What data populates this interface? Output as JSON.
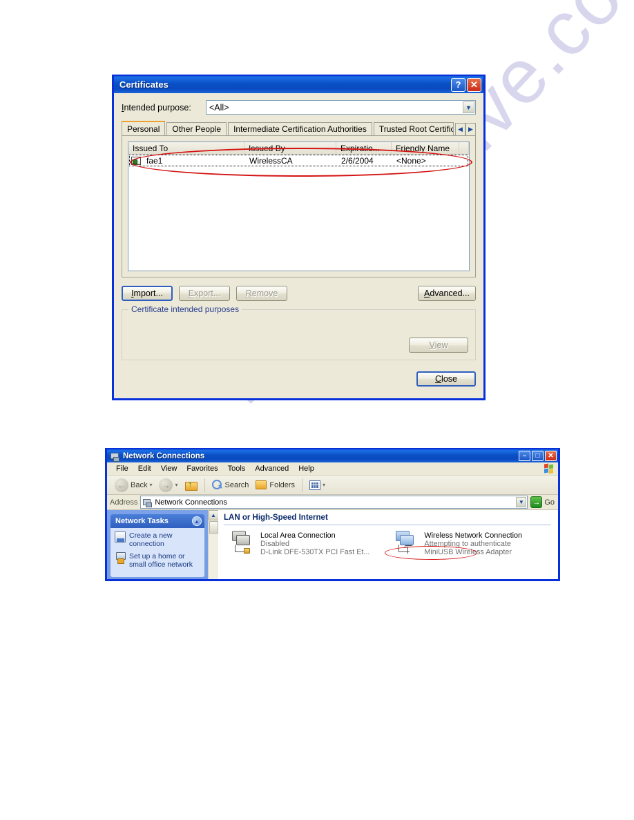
{
  "watermark": {
    "text": "manualshive.com"
  },
  "certificates_dialog": {
    "title": "Certificates",
    "titlebar_buttons": {
      "help": "?",
      "close": "✕"
    },
    "intended_purpose": {
      "label": "Intended purpose:",
      "label_mnemonic_prefix": "I",
      "label_mnemonic_char": "n",
      "label_rest": "tended purpose:",
      "value": "<All>",
      "arrow": "▼"
    },
    "tabs": [
      {
        "label": "Personal",
        "active": true
      },
      {
        "label": "Other People",
        "active": false
      },
      {
        "label": "Intermediate Certification Authorities",
        "active": false
      },
      {
        "label": "Trusted Root Certification",
        "active": false
      }
    ],
    "tab_scroll": {
      "left": "◀",
      "right": "▶"
    },
    "list": {
      "columns": [
        "Issued To",
        "Issued By",
        "Expiratio...",
        "Friendly Name"
      ],
      "rows": [
        {
          "issued_to": "fae1",
          "issued_by": "WirelessCA",
          "expiration": "2/6/2004",
          "friendly_name": "<None>",
          "selected": true
        }
      ]
    },
    "buttons": {
      "import": "Import...",
      "export": "Export...",
      "remove": "Remove",
      "advanced": "Advanced...",
      "view": "View",
      "close": "Close"
    },
    "group": {
      "title": "Certificate intended purposes",
      "content": ""
    }
  },
  "network_connections_window": {
    "title": "Network Connections",
    "titlebar_buttons": {
      "minimize": "–",
      "maximize": "□",
      "close": "✕"
    },
    "menus": [
      "File",
      "Edit",
      "View",
      "Favorites",
      "Tools",
      "Advanced",
      "Help"
    ],
    "toolbar": {
      "back": "Back",
      "forward": "",
      "up": "",
      "search": "Search",
      "folders": "Folders",
      "views": "",
      "caret": "▾"
    },
    "address_bar": {
      "label": "Address",
      "value": "Network Connections",
      "arrow": "▼",
      "go_label": "Go",
      "go_glyph": "→"
    },
    "sidebar": {
      "panel_title": "Network Tasks",
      "collapse_glyph": "▲",
      "tasks": [
        {
          "label": "Create a new connection",
          "icon": "new-connection-icon"
        },
        {
          "label": "Set up a home or small office network",
          "icon": "home-network-icon"
        }
      ]
    },
    "scrollbar": {
      "up": "▲",
      "down": "▼"
    },
    "main": {
      "group_header": "LAN or High-Speed Internet",
      "connections": [
        {
          "name": "Local Area Connection",
          "status": "Disabled",
          "device": "D-Link DFE-530TX PCI Fast Et...",
          "type": "lan"
        },
        {
          "name": "Wireless Network Connection",
          "status": "Attempting to authenticate",
          "device": "MiniUSB Wireless Adapter",
          "type": "wifi"
        }
      ]
    }
  },
  "annotations": {
    "accent_red": "#d41414",
    "certificate_row_highlight": "ellipse around certificate list row",
    "wireless_status_highlight": "ellipse around Attempting to authenticate"
  }
}
